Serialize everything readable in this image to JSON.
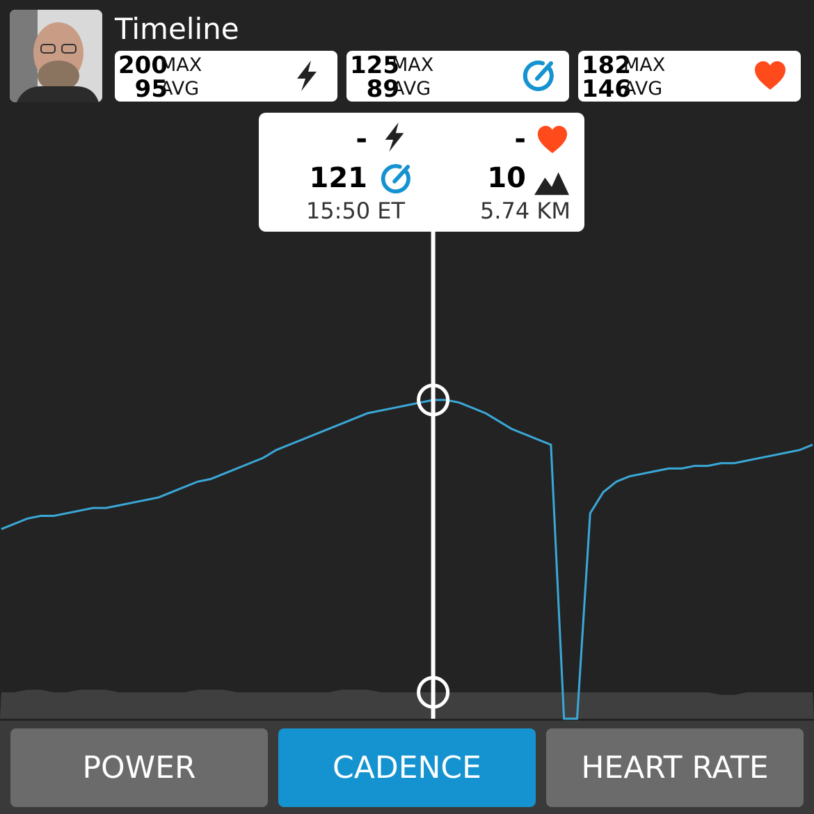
{
  "header": {
    "title": "Timeline"
  },
  "stats": [
    {
      "max": "200",
      "max_label": "MAX",
      "avg": "95",
      "avg_label": "AVG",
      "icon": "lightning-icon"
    },
    {
      "max": "125",
      "max_label": "MAX",
      "avg": "89",
      "avg_label": "AVG",
      "icon": "cadence-gauge-icon"
    },
    {
      "max": "182",
      "max_label": "MAX",
      "avg": "146",
      "avg_label": "AVG",
      "icon": "heart-icon"
    }
  ],
  "tooltip": {
    "power": "-",
    "heart_rate": "-",
    "cadence": "121",
    "elevation": "10",
    "time": "15:50 ET",
    "distance": "5.74 KM"
  },
  "tabs": [
    {
      "label": "POWER",
      "active": false
    },
    {
      "label": "CADENCE",
      "active": true
    },
    {
      "label": "HEART RATE",
      "active": false
    }
  ],
  "colors": {
    "accent": "#1593d0",
    "line": "#3aa8d8",
    "heart": "#ff4a1c",
    "background": "#232323",
    "elevation_fill": "#3f3f3f"
  },
  "chart_data": {
    "type": "line",
    "series": [
      {
        "values": [
          72,
          74,
          76,
          77,
          77,
          78,
          79,
          80,
          80,
          81,
          82,
          83,
          84,
          86,
          88,
          90,
          91,
          93,
          95,
          97,
          99,
          102,
          104,
          106,
          108,
          110,
          112,
          114,
          116,
          117,
          118,
          119,
          120,
          121,
          121,
          120,
          118,
          116,
          113,
          110,
          108,
          106,
          104,
          0,
          0,
          78,
          86,
          90,
          92,
          93,
          94,
          95,
          95,
          96,
          96,
          97,
          97,
          98,
          99,
          100,
          101,
          102,
          104
        ]
      },
      {
        "values": [
          10,
          10,
          11,
          11,
          10,
          10,
          11,
          11,
          11,
          10,
          10,
          10,
          10,
          10,
          10,
          11,
          11,
          11,
          10,
          10,
          10,
          10,
          10,
          10,
          10,
          10,
          11,
          11,
          11,
          10,
          10,
          10,
          10,
          10,
          10,
          10,
          10,
          10,
          10,
          10,
          10,
          10,
          10,
          10,
          10,
          10,
          10,
          10,
          10,
          10,
          10,
          10,
          10,
          10,
          10,
          9,
          9,
          10,
          10,
          10,
          10,
          10,
          10
        ]
      }
    ],
    "selected_index": 33,
    "ylim": [
      0,
      140
    ]
  }
}
